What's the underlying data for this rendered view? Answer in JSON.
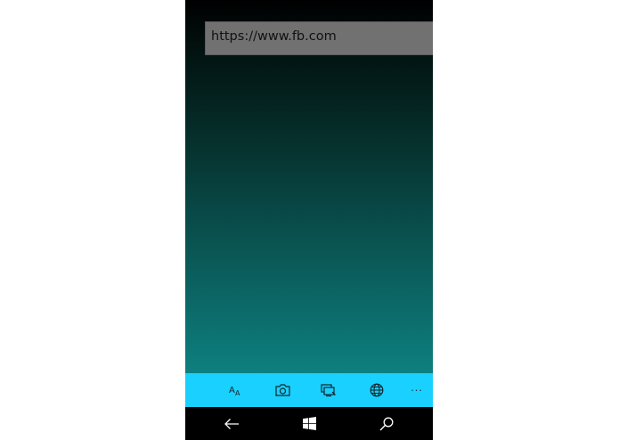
{
  "browser": {
    "address_bar": {
      "value": "https://www.fb.com"
    }
  },
  "toolbar": {
    "buttons": [
      {
        "name": "text-size",
        "icon": "text-size-icon"
      },
      {
        "name": "camera",
        "icon": "camera-icon"
      },
      {
        "name": "screen-capture",
        "icon": "screen-capture-icon"
      },
      {
        "name": "globe",
        "icon": "globe-icon"
      },
      {
        "name": "more",
        "icon": "more-icon",
        "label": "···"
      }
    ],
    "background_color": "#1ad0ff"
  },
  "navigation_bar": {
    "buttons": [
      {
        "name": "back",
        "icon": "back-arrow-icon"
      },
      {
        "name": "start",
        "icon": "windows-start-icon"
      },
      {
        "name": "search",
        "icon": "search-icon"
      }
    ]
  },
  "colors": {
    "gradient_top": "#000000",
    "gradient_bottom": "#0d807f",
    "address_bar_bg": "#717171"
  }
}
